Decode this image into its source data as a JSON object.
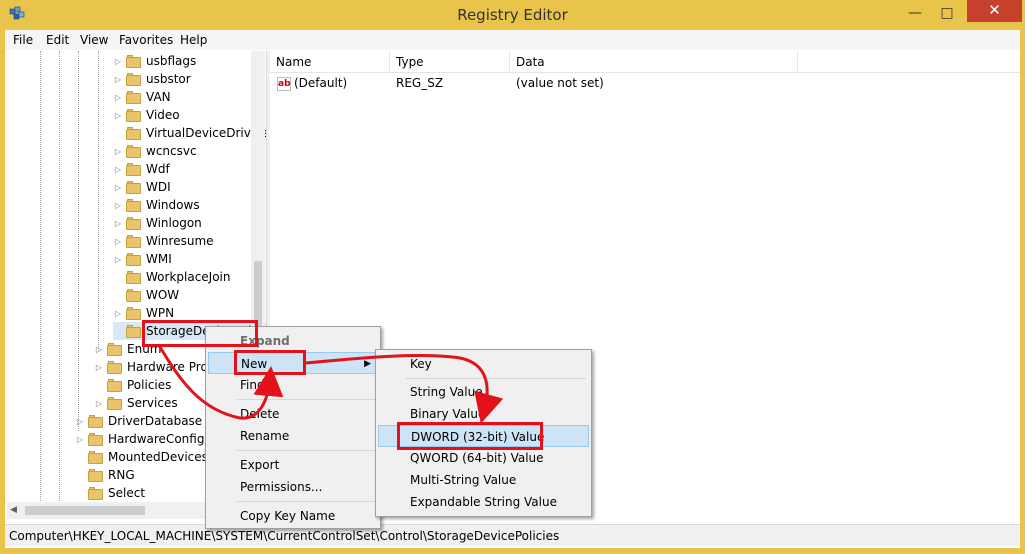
{
  "window": {
    "title": "Registry Editor",
    "minimize": "—",
    "maximize": "□",
    "close": "✕"
  },
  "menu": [
    "File",
    "Edit",
    "View",
    "Favorites",
    "Help"
  ],
  "tree": {
    "items": [
      {
        "label": "usbflags",
        "expander": "▷"
      },
      {
        "label": "usbstor",
        "expander": "▷"
      },
      {
        "label": "VAN",
        "expander": "▷"
      },
      {
        "label": "Video",
        "expander": "▷"
      },
      {
        "label": "VirtualDeviceDrivers",
        "expander": ""
      },
      {
        "label": "wcncsvc",
        "expander": "▷"
      },
      {
        "label": "Wdf",
        "expander": "▷"
      },
      {
        "label": "WDI",
        "expander": "▷"
      },
      {
        "label": "Windows",
        "expander": "▷"
      },
      {
        "label": "Winlogon",
        "expander": "▷"
      },
      {
        "label": "Winresume",
        "expander": "▷"
      },
      {
        "label": "WMI",
        "expander": "▷"
      },
      {
        "label": "WorkplaceJoin",
        "expander": ""
      },
      {
        "label": "WOW",
        "expander": ""
      },
      {
        "label": "WPN",
        "expander": "▷"
      },
      {
        "label": "StorageDevicePolicies",
        "expander": ""
      },
      {
        "label": "Enum",
        "expander": "▷"
      },
      {
        "label": "Hardware Profiles",
        "expander": "▷"
      },
      {
        "label": "Policies",
        "expander": ""
      },
      {
        "label": "Services",
        "expander": "▷"
      },
      {
        "label": "DriverDatabase",
        "expander": "▷"
      },
      {
        "label": "HardwareConfig",
        "expander": "▷"
      },
      {
        "label": "MountedDevices",
        "expander": ""
      },
      {
        "label": "RNG",
        "expander": ""
      },
      {
        "label": "Select",
        "expander": ""
      }
    ]
  },
  "list": {
    "columns": [
      "Name",
      "Type",
      "Data"
    ],
    "rows": [
      {
        "name": "(Default)",
        "type": "REG_SZ",
        "data": "(value not set)",
        "icon": "ab"
      }
    ]
  },
  "context_menu": {
    "items": [
      "Expand",
      "New",
      "Find...",
      "Delete",
      "Rename",
      "Export",
      "Permissions...",
      "Copy Key Name"
    ],
    "new_arrow": "▶"
  },
  "submenu": {
    "items": [
      "Key",
      "String Value",
      "Binary Value",
      "DWORD (32-bit) Value",
      "QWORD (64-bit) Value",
      "Multi-String Value",
      "Expandable String Value"
    ]
  },
  "status": {
    "path": "Computer\\HKEY_LOCAL_MACHINE\\SYSTEM\\CurrentControlSet\\Control\\StorageDevicePolicies"
  },
  "colors": {
    "title_bar": "#e8c54a",
    "close_button": "#c7402c",
    "highlight": "#cde3f6",
    "annotation": "#e3121a"
  }
}
